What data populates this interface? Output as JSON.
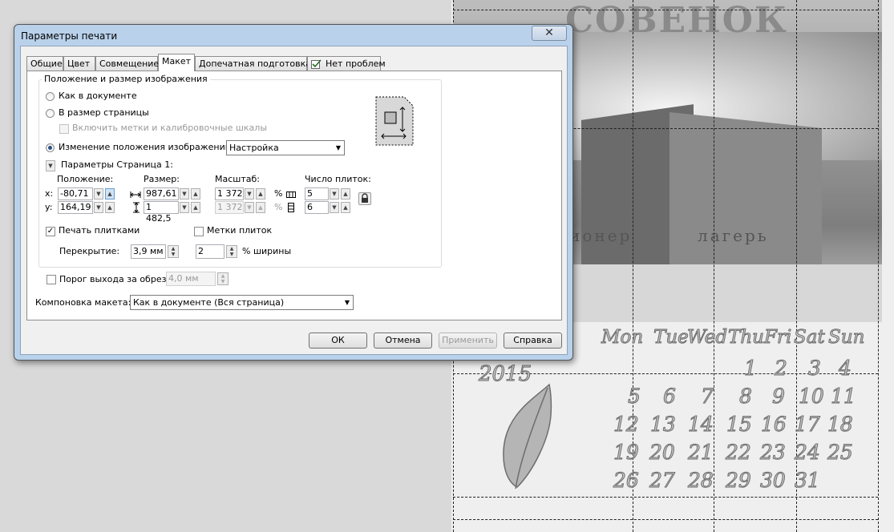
{
  "dialog": {
    "title": "Параметры печати",
    "close_symbol": "✕",
    "tabs": [
      "Общие",
      "Цвет",
      "Совмещение",
      "Макет",
      "Допечатная подготовка",
      "Нет проблем"
    ],
    "group_title": "Положение и размер изображения",
    "radio_as_doc": "Как в документе",
    "radio_page_size": "В размер страницы",
    "chk_marks": "Включить метки и калибровочные шкалы",
    "radio_reposition": "Изменение положения изображений на:",
    "reposition_value": "Настройка",
    "page_params": "Параметры Страница 1:",
    "hdr_position": "Положение:",
    "hdr_size": "Размер:",
    "hdr_scale": "Масштаб:",
    "hdr_tiles": "Число плиток:",
    "x_label": "x:",
    "y_label": "y:",
    "pos_x": "-80,71",
    "pos_y": "164,19",
    "size_w": "987,61",
    "size_h": "1 482,5",
    "scale_x": "1 372",
    "scale_y": "1 372",
    "percent": "%",
    "tiles_x": "5",
    "tiles_y": "6",
    "chk_tiles": "Печать плитками",
    "chk_tile_marks": "Метки плиток",
    "overlap_label": "Перекрытие:",
    "overlap_value": "3,9 мм",
    "overlap_count": "2",
    "overlap_unit": "% ширины",
    "bleed_label": "Порог выхода за обрез:",
    "bleed_value": "4,0 мм",
    "layout_label": "Компоновка макета:",
    "layout_value": "Как в документе (Вся страница)",
    "buttons": {
      "ok": "ОК",
      "cancel": "Отмена",
      "apply": "Применить",
      "help": "Справка"
    }
  },
  "calendar": {
    "sign": "СОВЕНОК",
    "sign_left": "ионер",
    "sign_right": "лагерь",
    "year": "2015",
    "days": [
      "Mon",
      "Tue",
      "Wed",
      "Thu",
      "Fri",
      "Sat",
      "Sun"
    ],
    "rows": [
      [
        "1",
        "2",
        "3",
        "4"
      ],
      [
        "5",
        "6",
        "7",
        "8",
        "9",
        "10",
        "11"
      ],
      [
        "12",
        "13",
        "14",
        "15",
        "16",
        "17",
        "18"
      ],
      [
        "19",
        "20",
        "21",
        "22",
        "23",
        "24",
        "25"
      ],
      [
        "26",
        "27",
        "28",
        "29",
        "30",
        "31"
      ]
    ]
  }
}
